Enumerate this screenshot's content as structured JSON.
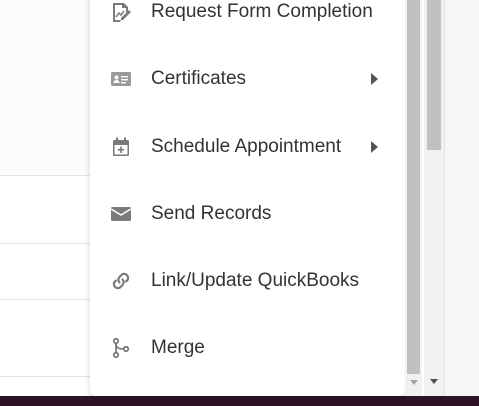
{
  "menu": {
    "items": [
      {
        "label": "Request Form Completion",
        "icon": "form-edit-icon",
        "submenu": false
      },
      {
        "label": "Certificates",
        "icon": "id-card-icon",
        "submenu": true
      },
      {
        "label": "Schedule Appointment",
        "icon": "calendar-plus-icon",
        "submenu": true
      },
      {
        "label": "Send Records",
        "icon": "envelope-icon",
        "submenu": false
      },
      {
        "label": "Link/Update QuickBooks",
        "icon": "link-icon",
        "submenu": false
      },
      {
        "label": "Merge",
        "icon": "merge-icon",
        "submenu": false
      }
    ]
  },
  "colors": {
    "menu_text": "#333333",
    "icon": "#7a7a7a",
    "bottom_bar": "#2e1226"
  }
}
